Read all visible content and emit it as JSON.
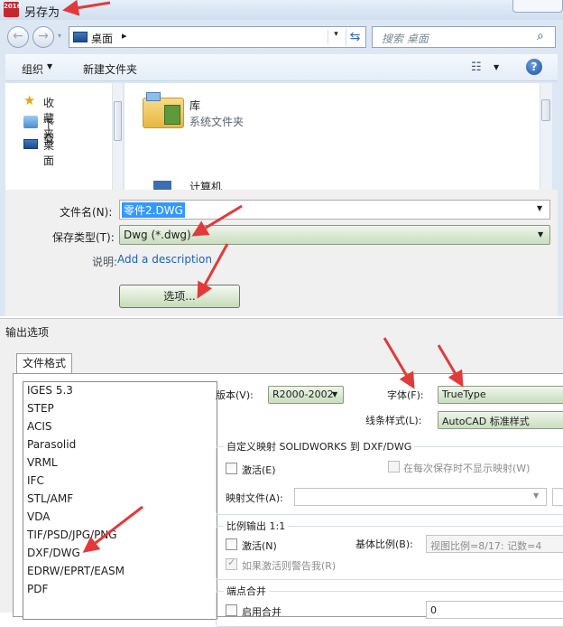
{
  "save_dialog": {
    "title": "另存为",
    "app_logo_text": "2016",
    "address": {
      "location": "桌面",
      "chevron": "▸"
    },
    "search": {
      "placeholder": "搜索 桌面"
    },
    "toolbar": {
      "organize": "组织",
      "new_folder": "新建文件夹"
    },
    "nav_pane": {
      "items": [
        {
          "label": "收藏夹",
          "icon": "star-icon"
        },
        {
          "label": "下载",
          "icon": "download-icon"
        },
        {
          "label": "桌面",
          "icon": "desktop-icon"
        }
      ]
    },
    "files": [
      {
        "name": "库",
        "description": "系统文件夹",
        "icon": "library-icon"
      },
      {
        "name": "计算机",
        "icon": "computer-icon"
      }
    ],
    "file_name": {
      "label": "文件名(N):",
      "value": "零件2.DWG"
    },
    "save_type": {
      "label": "保存类型(T):",
      "value": "Dwg (*.dwg)"
    },
    "description": {
      "label": "说明:",
      "link": "Add a description"
    },
    "options_button": "选项..."
  },
  "export_dialog": {
    "title": "输出选项",
    "tab": "文件格式",
    "formats": [
      "IGES 5.3",
      "STEP",
      "ACIS",
      "Parasolid",
      "VRML",
      "IFC",
      "STL/AMF",
      "VDA",
      "TIF/PSD/JPG/PNG",
      "DXF/DWG",
      "EDRW/EPRT/EASM",
      "PDF"
    ],
    "selected_format": "DXF/DWG",
    "version": {
      "label": "版本(V):",
      "value": "R2000-2002"
    },
    "font": {
      "label": "字体(F):",
      "value": "TrueType"
    },
    "line_style": {
      "label": "线条样式(L):",
      "value": "AutoCAD 标准样式"
    },
    "custom_map": {
      "title": "自定义映射 SOLIDWORKS 到 DXF/DWG",
      "activate": "激活(E)",
      "no_show_on_save": "在每次保存时不显示映射(W)",
      "map_file_label": "映射文件(A):"
    },
    "scale_output": {
      "title": "比例输出 1:1",
      "activate": "激活(N)",
      "warn_if_activated": "如果激活则警告我(R)",
      "base_scale_label": "基体比例(B):",
      "base_scale_value": "视图比例=8/17: 记数=4"
    },
    "endpoint_merge": {
      "title": "端点合并",
      "enable": "启用合并",
      "value": "0"
    }
  },
  "colors": {
    "annotation_arrow": "#e23a3a",
    "link": "#1c61b6",
    "selection": "#3399ff"
  }
}
